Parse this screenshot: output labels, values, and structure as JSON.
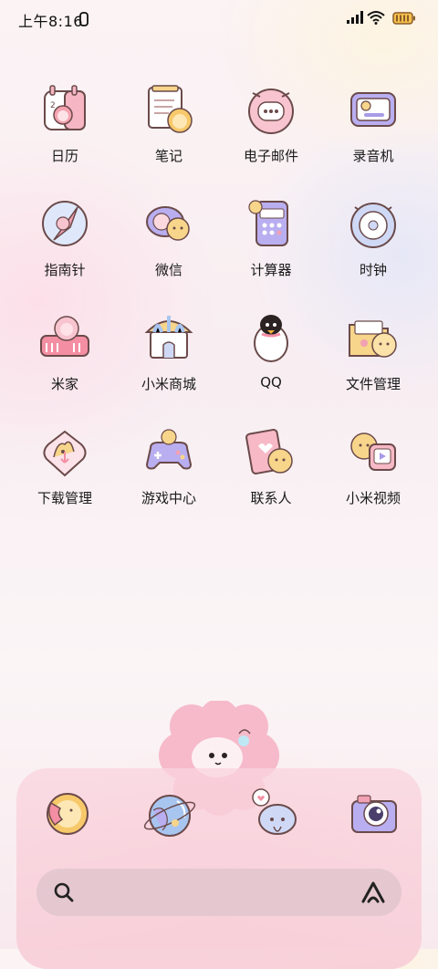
{
  "status_bar": {
    "time": "上午8:16",
    "icons": [
      "rotate-lock-icon",
      "signal-icon",
      "wifi-icon",
      "battery-icon"
    ]
  },
  "apps": [
    {
      "label": "日历",
      "icon": "calendar-icon"
    },
    {
      "label": "笔记",
      "icon": "notes-icon"
    },
    {
      "label": "电子邮件",
      "icon": "email-icon"
    },
    {
      "label": "录音机",
      "icon": "recorder-icon"
    },
    {
      "label": "指南针",
      "icon": "compass-icon"
    },
    {
      "label": "微信",
      "icon": "wechat-icon"
    },
    {
      "label": "计算器",
      "icon": "calculator-icon"
    },
    {
      "label": "时钟",
      "icon": "clock-icon"
    },
    {
      "label": "米家",
      "icon": "mijia-icon"
    },
    {
      "label": "小米商城",
      "icon": "mi-store-icon"
    },
    {
      "label": "QQ",
      "icon": "qq-penguin-icon"
    },
    {
      "label": "文件管理",
      "icon": "file-manager-icon"
    },
    {
      "label": "下载管理",
      "icon": "download-manager-icon"
    },
    {
      "label": "游戏中心",
      "icon": "game-center-icon"
    },
    {
      "label": "联系人",
      "icon": "contacts-icon"
    },
    {
      "label": "小米视频",
      "icon": "mi-video-icon"
    }
  ],
  "dock": {
    "apps": [
      "phone-icon",
      "browser-icon",
      "messages-icon",
      "camera-icon"
    ]
  },
  "search_bar": {
    "icon": "search-icon",
    "assistant_icon": "xiaoai-icon"
  },
  "colors": {
    "accent_pink": "#f3a9b9",
    "accent_purple": "#a89be6",
    "accent_yellow": "#f7d58a",
    "outline": "#6b4a4a"
  }
}
